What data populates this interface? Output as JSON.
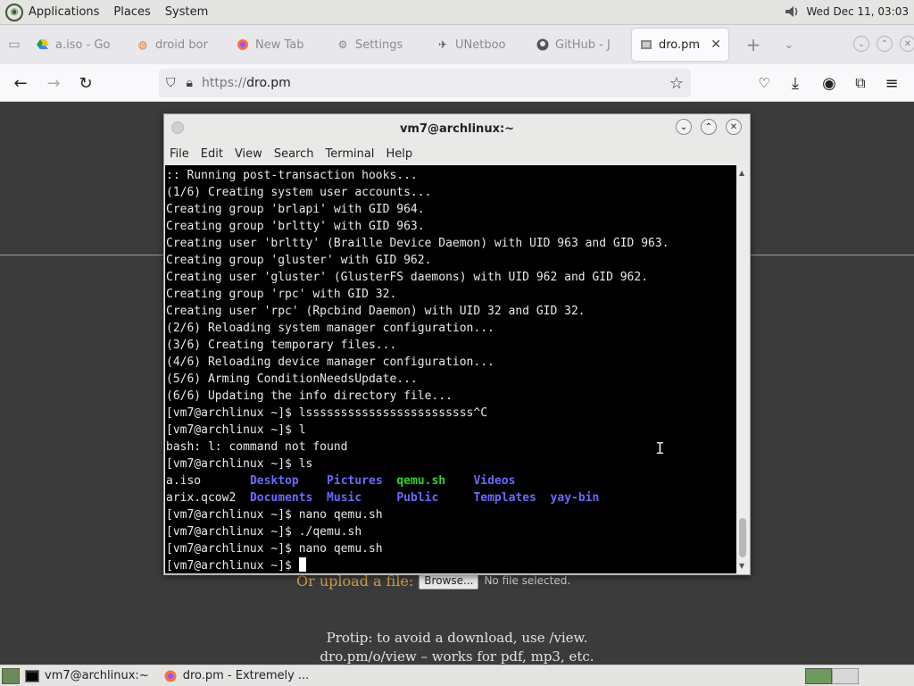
{
  "system_panel": {
    "menus": [
      "Applications",
      "Places",
      "System"
    ],
    "clock": "Wed Dec 11, 03:03"
  },
  "browser": {
    "tabs": [
      {
        "label": "a.iso - Go",
        "icon": "google-drive-icon"
      },
      {
        "label": "droid bor",
        "icon": "droid-icon"
      },
      {
        "label": "New Tab",
        "icon": "firefox-icon"
      },
      {
        "label": "Settings",
        "icon": "gear-icon"
      },
      {
        "label": "UNetboo",
        "icon": "unetbootin-icon"
      },
      {
        "label": "GitHub - J",
        "icon": "github-icon"
      },
      {
        "label": "dro.pm",
        "icon": "dro-icon",
        "active": true
      }
    ],
    "url_protocol": "https://",
    "url_host": "dro.pm"
  },
  "page": {
    "upload_label": "Or upload a file:",
    "browse_label": "Browse...",
    "no_file_label": "No file selected.",
    "protip_line1": "Protip: to avoid a download, use /view.",
    "protip_line2": "dro.pm/o/view – works for pdf, mp3, etc."
  },
  "terminal": {
    "title": "vm7@archlinux:~",
    "menu": [
      "File",
      "Edit",
      "View",
      "Search",
      "Terminal",
      "Help"
    ],
    "lines": [
      ":: Running post-transaction hooks...",
      "(1/6) Creating system user accounts...",
      "Creating group 'brlapi' with GID 964.",
      "Creating group 'brltty' with GID 963.",
      "Creating user 'brltty' (Braille Device Daemon) with UID 963 and GID 963.",
      "Creating group 'gluster' with GID 962.",
      "Creating user 'gluster' (GlusterFS daemons) with UID 962 and GID 962.",
      "Creating group 'rpc' with GID 32.",
      "Creating user 'rpc' (Rpcbind Daemon) with UID 32 and GID 32.",
      "(2/6) Reloading system manager configuration...",
      "(3/6) Creating temporary files...",
      "(4/6) Reloading device manager configuration...",
      "(5/6) Arming ConditionNeedsUpdate...",
      "(6/6) Updating the info directory file...",
      "[vm7@archlinux ~]$ lssssssssssssssssssssssss^C",
      "[vm7@archlinux ~]$ l",
      "bash: l: command not found",
      "[vm7@archlinux ~]$ ls"
    ],
    "ls_row1": [
      {
        "t": "a.iso",
        "c": "plain",
        "w": 12
      },
      {
        "t": "Desktop",
        "c": "blue",
        "w": 11
      },
      {
        "t": "Pictures",
        "c": "blue",
        "w": 10
      },
      {
        "t": "qemu.sh",
        "c": "green",
        "w": 11
      },
      {
        "t": "Videos",
        "c": "blue",
        "w": 0
      }
    ],
    "ls_row2": [
      {
        "t": "arix.qcow2",
        "c": "plain",
        "w": 12
      },
      {
        "t": "Documents",
        "c": "blue",
        "w": 11
      },
      {
        "t": "Music",
        "c": "blue",
        "w": 10
      },
      {
        "t": "Public",
        "c": "blue",
        "w": 11
      },
      {
        "t": "Templates",
        "c": "blue",
        "w": 0
      }
    ],
    "ls_row2_extra": {
      "t": "yay-bin",
      "c": "blue"
    },
    "lines_after": [
      "[vm7@archlinux ~]$ nano qemu.sh",
      "[vm7@archlinux ~]$ ./qemu.sh",
      "[vm7@archlinux ~]$ nano qemu.sh"
    ],
    "prompt": "[vm7@archlinux ~]$ "
  },
  "taskbar": {
    "items": [
      {
        "label": "vm7@archlinux:~",
        "icon": "terminal-icon"
      },
      {
        "label": "dro.pm - Extremely ...",
        "icon": "firefox-icon"
      }
    ]
  },
  "colors": {
    "ls_directory": "#6a6aff",
    "ls_executable": "#2fd62f",
    "upload_label": "#d4a04a"
  }
}
